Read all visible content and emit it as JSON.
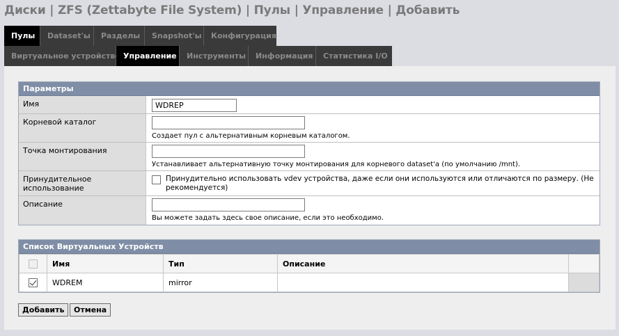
{
  "breadcrumb": "Диски | ZFS (Zettabyte File System) | Пулы | Управление | Добавить",
  "tabs_primary": [
    "Пулы",
    "Dataset'ы",
    "Разделы",
    "Snapshot'ы",
    "Конфигурация"
  ],
  "tabs_secondary": [
    "Виртуальное устройство",
    "Управление",
    "Инструменты",
    "Информация",
    "Статистика I/O"
  ],
  "params": {
    "header": "Параметры",
    "name_label": "Имя",
    "name_value": "WDREP",
    "root_label": "Корневой каталог",
    "root_value": "",
    "root_hint": "Создает пул с альтернативным корневым каталогом.",
    "mount_label": "Точка монтирования",
    "mount_value": "",
    "mount_hint": "Устанавливает альтернативную точку монтирования для корневого dataset'a (по умолчанию /mnt).",
    "force_label": "Принудительное использование",
    "force_text": "Принудительно использовать vdev устройства, даже если они используются или отличаются по размеру. (Не рекомендуется)",
    "force_checked": false,
    "desc_label": "Описание",
    "desc_value": "",
    "desc_hint": "Вы можете задать здесь свое описание, если это необходимо."
  },
  "vdev": {
    "header": "Список Виртуальных Устройств",
    "columns": [
      "Имя",
      "Тип",
      "Описание"
    ],
    "rows": [
      {
        "checked": true,
        "name": "WDREM",
        "type": "mirror",
        "description": ""
      }
    ]
  },
  "buttons": {
    "add": "Добавить",
    "cancel": "Отмена"
  },
  "colors": {
    "section_header": "#7f8ea6",
    "tab_bg": "#3a3a3a",
    "tab_active": "#000000"
  }
}
